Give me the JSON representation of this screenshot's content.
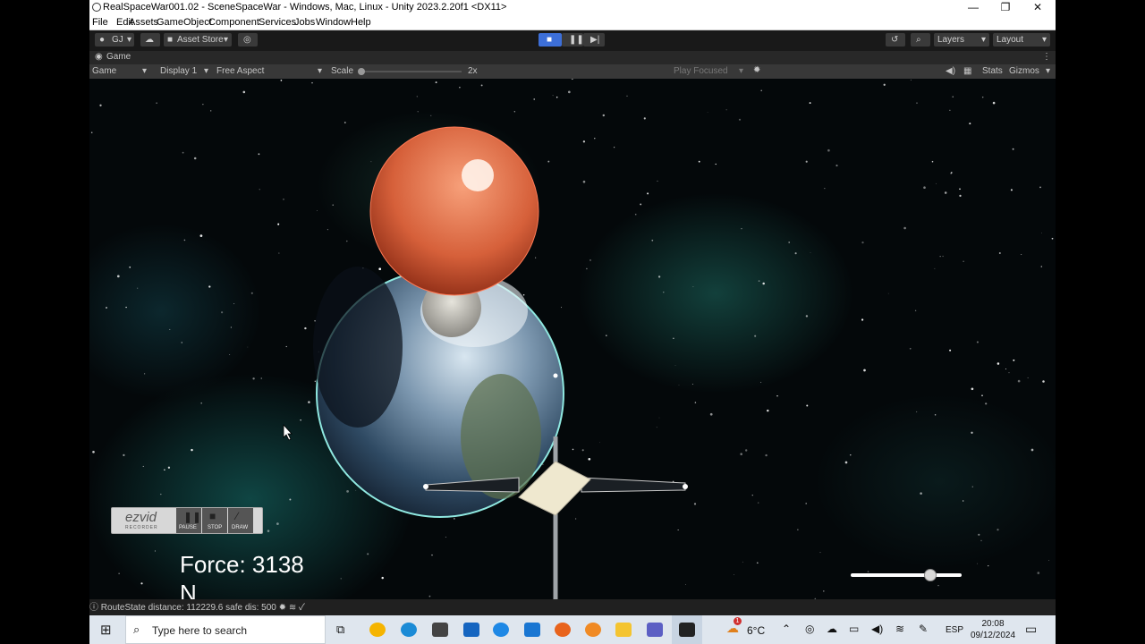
{
  "window": {
    "title": "RealSpaceWar001.02 - SceneSpaceWar - Windows, Mac, Linux - Unity 2023.2.20f1 <DX11>",
    "controls": {
      "minimize": "—",
      "maximize": "❐",
      "close": "✕"
    }
  },
  "menu": [
    "File",
    "Edit",
    "Assets",
    "GameObject",
    "Component",
    "Services",
    "Jobs",
    "Window",
    "Help"
  ],
  "toolbar": {
    "account": "GJ",
    "asset_store": "Asset Store",
    "layers": "Layers",
    "layout": "Layout"
  },
  "tab": {
    "label": "Game"
  },
  "gamebar": {
    "view": "Game",
    "display": "Display 1",
    "aspect": "Free Aspect",
    "scale_label": "Scale",
    "scale_value": "2x",
    "play_mode": "Play Focused",
    "stats": "Stats",
    "gizmos": "Gizmos"
  },
  "hud": {
    "force_line1": "Force: 3138",
    "force_line2": "N",
    "slider_value": 0.72
  },
  "recorder": {
    "brand": "ezvid",
    "sub": "RECORDER",
    "pause": "PAUSE",
    "stop": "STOP",
    "draw": "DRAW"
  },
  "status": {
    "message": "RouteState distance: 112229.6 safe dis: 500"
  },
  "taskbar": {
    "search_placeholder": "Type here to search",
    "weather": "6°C",
    "weather_badge": "1",
    "language": "ESP",
    "time": "20:08",
    "date": "09/12/2024"
  },
  "colors": {
    "unity_dark": "#191919",
    "toolbar_button": "#3a3a3a",
    "taskbar": "#dfe6ee",
    "play_active": "#3d6fd8"
  }
}
